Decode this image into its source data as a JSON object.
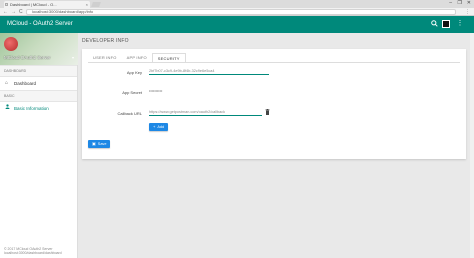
{
  "browser": {
    "tab_title": "Dashboard | MCloud - O...",
    "tab_close": "×",
    "url": "localhost:3000/dashboard/app/info",
    "window_controls": [
      "–",
      "❐",
      "✕"
    ],
    "nav": [
      "←",
      "→",
      "C"
    ]
  },
  "appbar": {
    "title": "MCloud - OAuth2 Server",
    "icons": [
      "search-icon",
      "more-icon"
    ]
  },
  "sidebar": {
    "hero_title": "MCloud OAuth2 Server",
    "hero_caret": "▾",
    "sections": [
      {
        "label": "DASHBOARD",
        "items": [
          {
            "label": "Dashboard",
            "icon": "⌂"
          }
        ]
      },
      {
        "label": "BASIC",
        "items": [
          {
            "label": "Basic Information",
            "icon": "👤"
          }
        ]
      }
    ],
    "footer_line1": "© 2017 MCloud OAuth2 Server",
    "footer_line2": "localhost:3000/dashboard/dashboard"
  },
  "main": {
    "page_title": "DEVELOPER INFO",
    "tabs": [
      "USER INFO",
      "APP INFO",
      "SECURITY"
    ],
    "active_tab": 2,
    "fields": {
      "app_key_label": "App Key",
      "app_key_value": "2bf7b07-c3c9-4e9b-8f4b-32c9e6e5ca4",
      "app_secret_label": "App Secret",
      "app_secret_value": "••••••••••",
      "callback_label": "Callback URL",
      "callback_value": "https://www.getpostman.com/oauth2/callback"
    },
    "add_button": "Add",
    "save_button": "Save"
  },
  "colors": {
    "accent": "#00897b",
    "button": "#1e88e5"
  }
}
